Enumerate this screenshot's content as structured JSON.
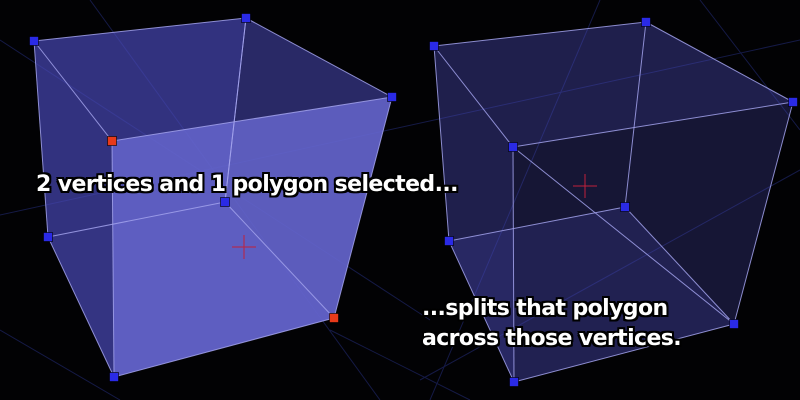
{
  "captions": {
    "top": "2 vertices and 1 polygon selected...",
    "bottom_line1": "...splits that polygon",
    "bottom_line2": "across those vertices."
  },
  "colors": {
    "background": "#020204",
    "grid_line": "#151a46",
    "face": "#4a4ab8",
    "selected_face": "#6464cc",
    "edge": "#a2a2ec",
    "vertex": "#2a2ae6",
    "selected_vertex": "#e83a1a",
    "center_cross": "#c0203a"
  },
  "scenes": [
    {
      "name": "before",
      "selected_face": [
        "v_a",
        "v_b",
        "v_c",
        "v_d"
      ],
      "selected_vertices": [
        "v_a",
        "v_c"
      ]
    },
    {
      "name": "after",
      "split_edge": [
        "w_b",
        "w_j"
      ],
      "selected_vertices": []
    }
  ]
}
